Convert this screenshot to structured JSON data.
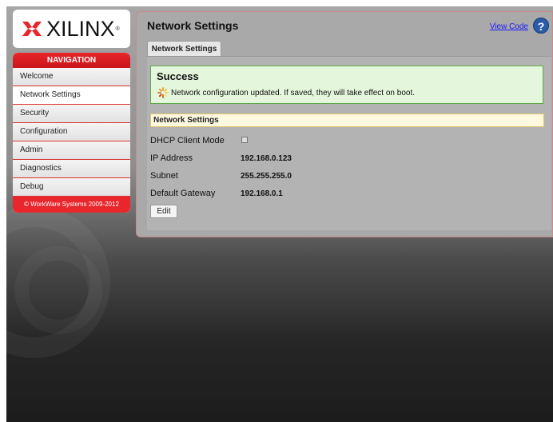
{
  "logo": {
    "text": "XILINX",
    "reg": "®"
  },
  "nav": {
    "header": "NAVIGATION",
    "items": [
      {
        "label": "Welcome",
        "active": false
      },
      {
        "label": "Network Settings",
        "active": true
      },
      {
        "label": "Security",
        "active": false
      },
      {
        "label": "Configuration",
        "active": false
      },
      {
        "label": "Admin",
        "active": false
      },
      {
        "label": "Diagnostics",
        "active": false
      },
      {
        "label": "Debug",
        "active": false
      }
    ],
    "footer": "© WorkWare Systems 2009-2012"
  },
  "header": {
    "title": "Network Settings",
    "view_code": "View Code",
    "help_glyph": "?"
  },
  "tab": {
    "label": "Network Settings"
  },
  "success": {
    "title": "Success",
    "message": "Network configuration updated. If saved, they will take effect on boot."
  },
  "section": {
    "title": "Network Settings"
  },
  "fields": {
    "dhcp_label": "DHCP Client Mode",
    "dhcp_checked": false,
    "ip_label": "IP Address",
    "ip_value": "192.168.0.123",
    "subnet_label": "Subnet",
    "subnet_value": "255.255.255.0",
    "gateway_label": "Default Gateway",
    "gateway_value": "192.168.0.1"
  },
  "buttons": {
    "edit": "Edit"
  },
  "colors": {
    "brand_red": "#e8262b",
    "success_bg": "#e4f7dc",
    "section_bg": "#fff9e0",
    "link_blue": "#1a1aff"
  }
}
